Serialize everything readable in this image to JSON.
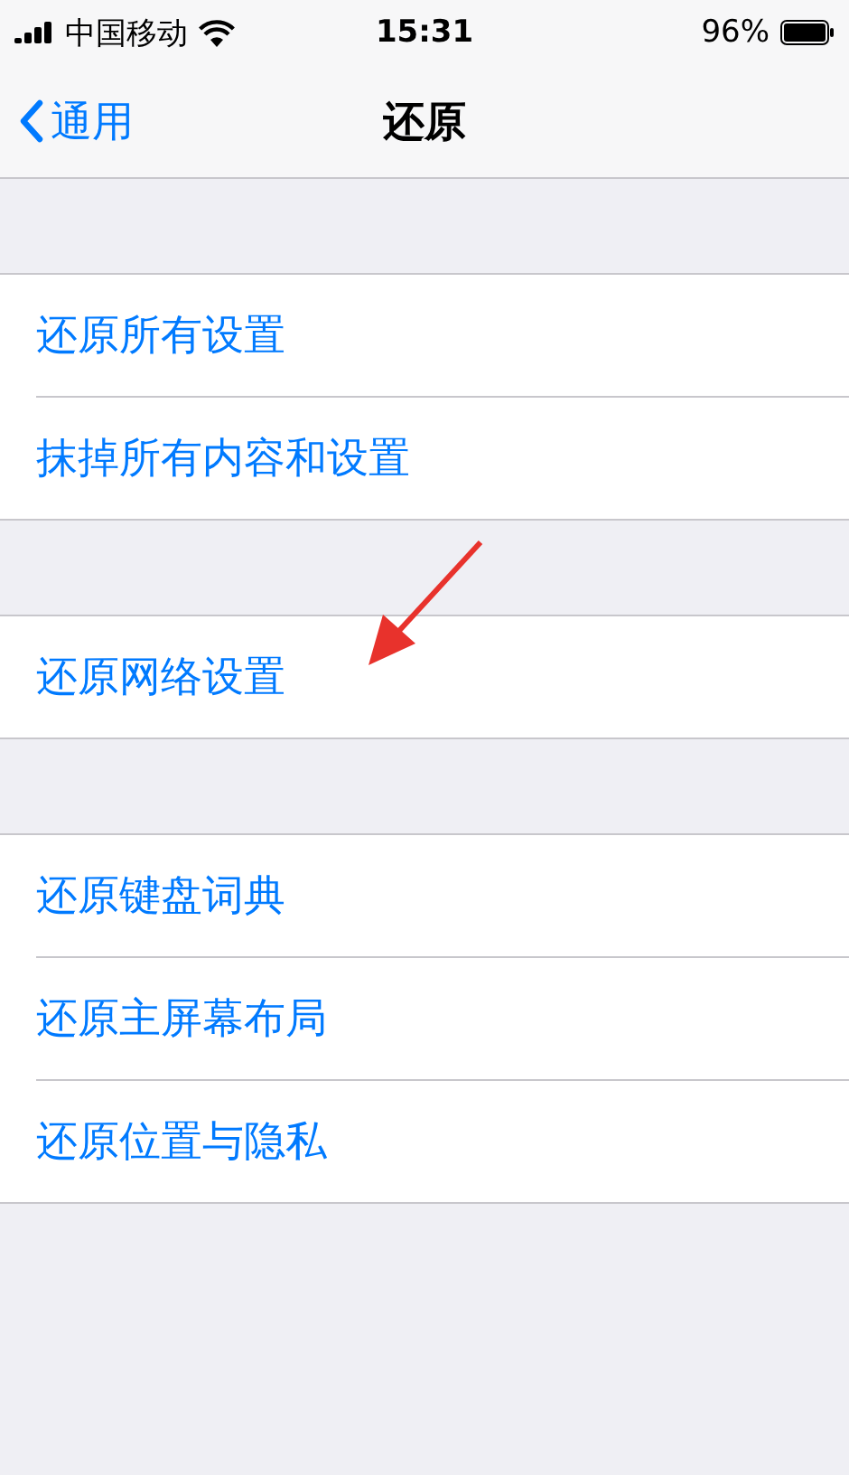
{
  "status_bar": {
    "carrier": "中国移动",
    "time": "15:31",
    "battery": "96%"
  },
  "nav": {
    "back": "通用",
    "title": "还原"
  },
  "groups": [
    {
      "items": [
        "还原所有设置",
        "抹掉所有内容和设置"
      ]
    },
    {
      "items": [
        "还原网络设置"
      ]
    },
    {
      "items": [
        "还原键盘词典",
        "还原主屏幕布局",
        "还原位置与隐私"
      ]
    }
  ],
  "annotations": [
    {
      "kind": "arrow"
    }
  ]
}
